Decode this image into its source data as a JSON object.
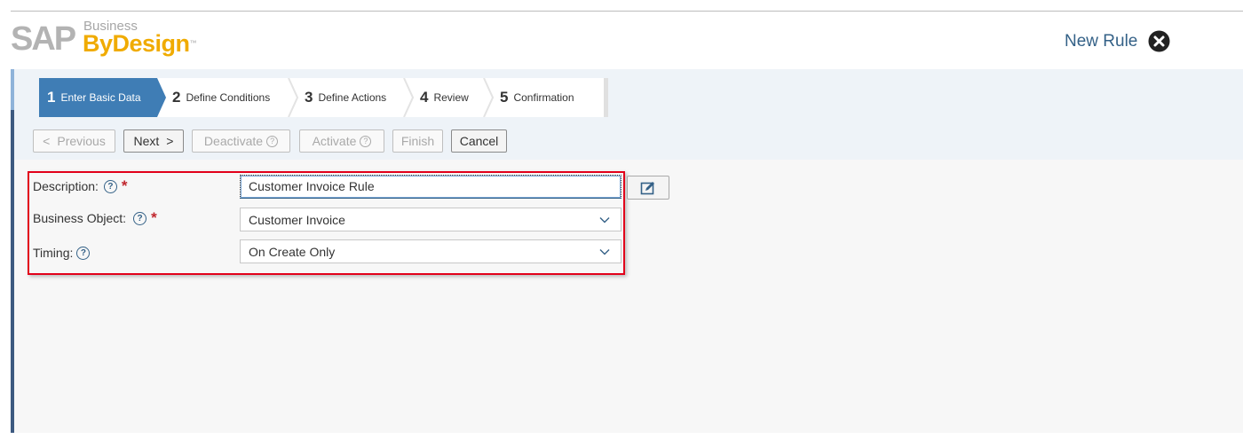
{
  "logo": {
    "sap": "SAP",
    "business": "Business",
    "bydesign": "ByDesign",
    "tm": "™"
  },
  "window": {
    "title": "New Rule"
  },
  "roadmap": {
    "steps": [
      {
        "num": "1",
        "label": "Enter Basic Data",
        "active": true
      },
      {
        "num": "2",
        "label": "Define Conditions"
      },
      {
        "num": "3",
        "label": "Define Actions"
      },
      {
        "num": "4",
        "label": "Review"
      },
      {
        "num": "5",
        "label": "Confirmation"
      }
    ]
  },
  "toolbar": {
    "previous": "Previous",
    "previous_glyph": "<",
    "next": "Next",
    "next_glyph": ">",
    "deactivate": "Deactivate",
    "activate": "Activate",
    "finish": "Finish",
    "cancel": "Cancel",
    "help_glyph": "?"
  },
  "form": {
    "description": {
      "label": "Description:",
      "required": "*",
      "value": "Customer Invoice Rule"
    },
    "business_object": {
      "label": "Business Object:",
      "required": "*",
      "value": "Customer Invoice"
    },
    "timing": {
      "label": "Timing:",
      "value": "On Create Only"
    },
    "help_glyph": "?"
  },
  "colors": {
    "accent": "#3f7db5",
    "title": "#346187",
    "highlight_border": "#e2001a",
    "logo_yellow": "#f0ab00"
  }
}
